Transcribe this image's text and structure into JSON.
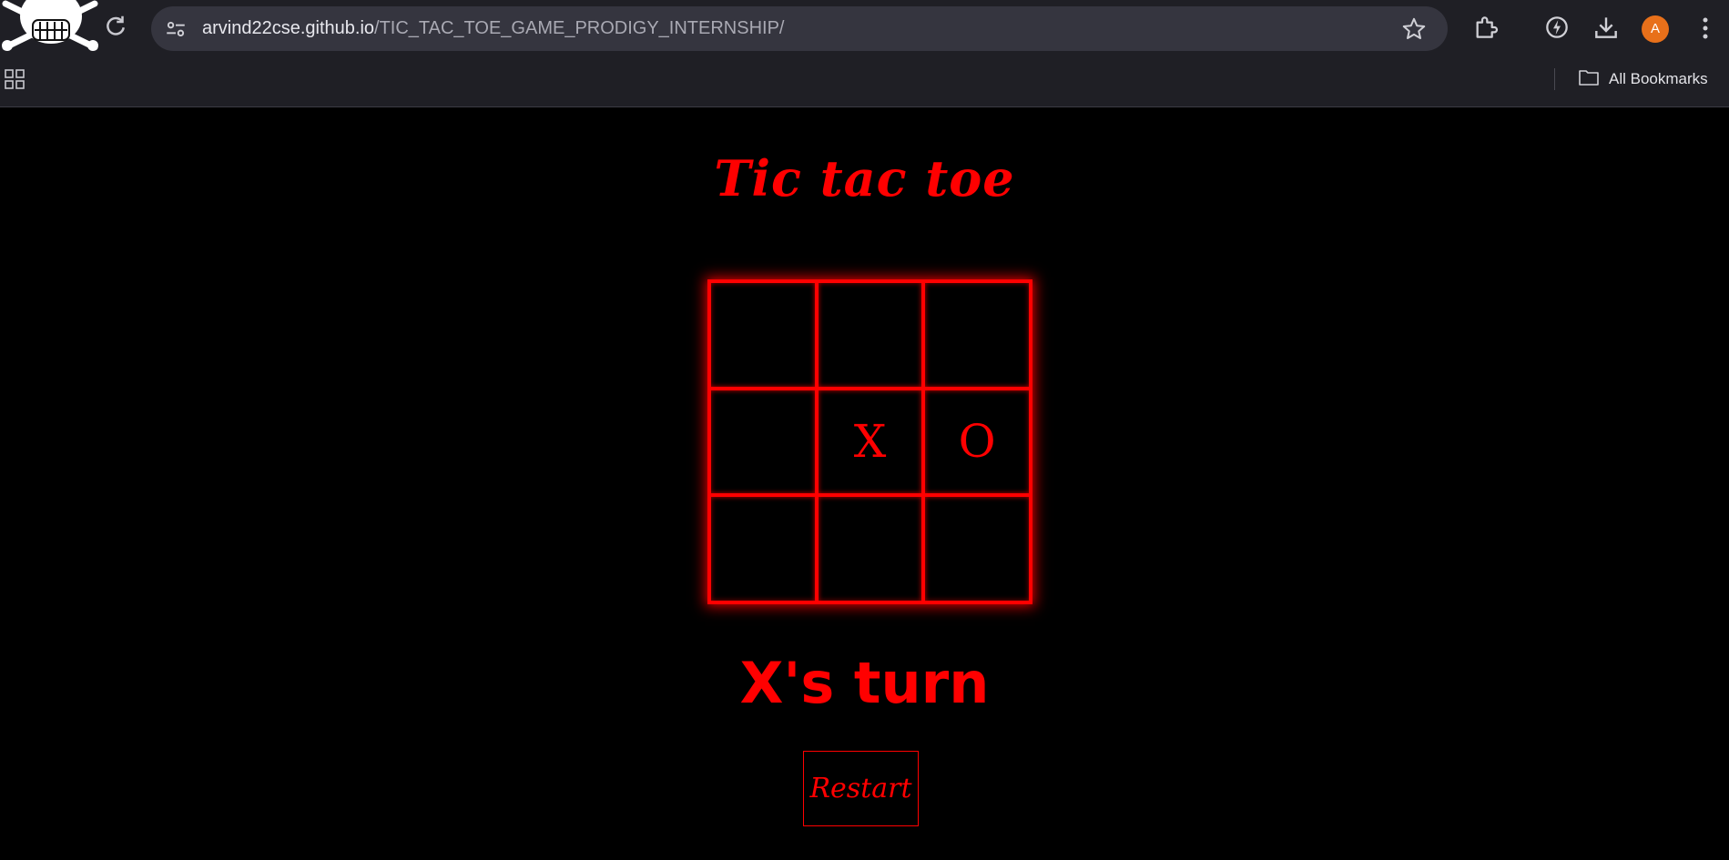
{
  "browser": {
    "url_domain": "arvind22cse.github.io",
    "url_path": "/TIC_TAC_TOE_GAME_PRODIGY_INTERNSHIP/",
    "profile_initial": "A",
    "bookmarks_label": "All Bookmarks",
    "profile_color": "#e8701a"
  },
  "game": {
    "title": "Tic tac toe",
    "cells": [
      "",
      "",
      "",
      "",
      "X",
      "O",
      "",
      "",
      ""
    ],
    "status": "X's turn",
    "restart_label": "Restart",
    "accent": "#ff0000",
    "background": "#000000"
  }
}
